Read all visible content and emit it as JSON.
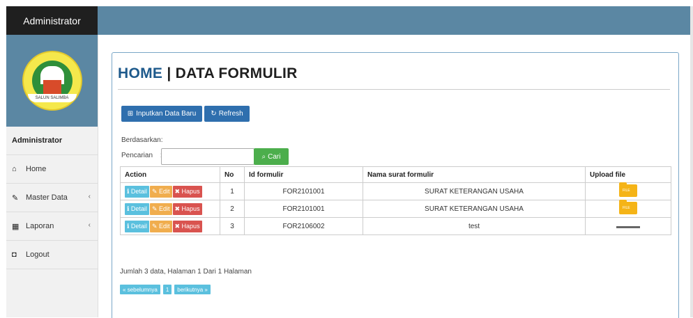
{
  "sidebar": {
    "title": "Administrator",
    "logo_ribbon": "SALUN SALIMBA",
    "role": "Administrator",
    "items": [
      {
        "icon": "home-icon",
        "glyph": "⌂",
        "label": "Home"
      },
      {
        "icon": "edit-icon",
        "glyph": "✎",
        "label": "Master Data",
        "chevron": "‹"
      },
      {
        "icon": "calendar-icon",
        "glyph": "▦",
        "label": "Laporan",
        "chevron": "‹"
      },
      {
        "icon": "logout-icon",
        "glyph": "◘",
        "label": "Logout"
      }
    ]
  },
  "header": {
    "title_home": "HOME",
    "title_sep": " | ",
    "title_page": "DATA FORMULIR"
  },
  "toolbar": {
    "new_label": "Inputkan Data Baru",
    "refresh_label": "Refresh",
    "new_icon": "plus-square-icon",
    "refresh_icon": "refresh-icon"
  },
  "search": {
    "berdasarkan_label": "Berdasarkan:",
    "pencarian_label": "Pencarian",
    "colon": ":",
    "value": "",
    "button_label": "Cari"
  },
  "table": {
    "headers": [
      "Action",
      "No",
      "Id formulir",
      "Nama surat formulir",
      "Upload file"
    ],
    "action_labels": {
      "detail": "Detail",
      "edit": "Edit",
      "hapus": "Hapus"
    },
    "rows": [
      {
        "no": "1",
        "id": "FOR2101001",
        "nama": "SURAT KETERANGAN USAHA",
        "file": "folder"
      },
      {
        "no": "2",
        "id": "FOR2101001",
        "nama": "SURAT KETERANGAN USAHA",
        "file": "folder"
      },
      {
        "no": "3",
        "id": "FOR2106002",
        "nama": "test",
        "file": "image"
      }
    ],
    "folder_text": "FILE"
  },
  "footer": {
    "summary": "Jumlah 3 data, Halaman 1 Dari 1 Halaman",
    "prev": "« sebelumnya",
    "page": "1",
    "next": "berikutnya »"
  },
  "colors": {
    "topbar": "#5b87a3",
    "title_blue": "#1e5a8c",
    "primary": "#2f6fae",
    "success": "#4cae4c",
    "info": "#5bc0de",
    "warning": "#f0ad4e",
    "danger": "#d9534f"
  }
}
